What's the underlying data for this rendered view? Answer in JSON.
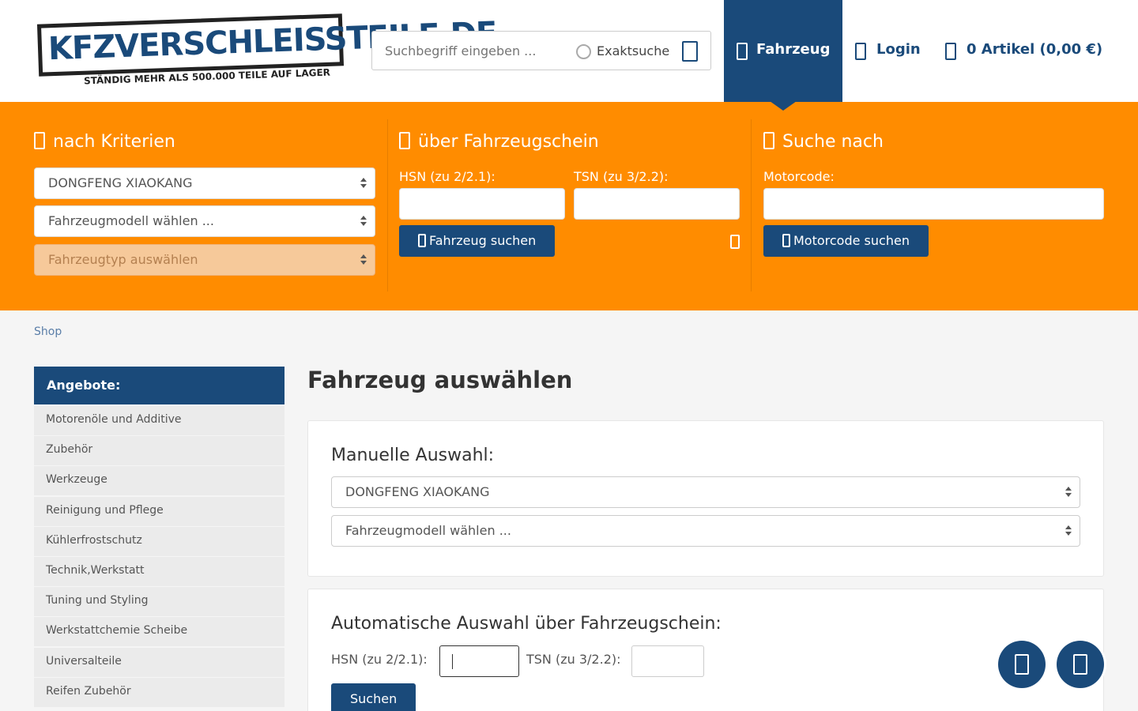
{
  "header": {
    "logo_text": "KFZVERSCHLEISSTEILE.DE",
    "logo_sub": "STÄNDIG MEHR ALS 500.000 TEILE AUF LAGER",
    "search_placeholder": "Suchbegriff eingeben ...",
    "exakt_label": "Exaktsuche",
    "nav_fahrzeug": "Fahrzeug",
    "nav_login": "Login",
    "nav_cart": "0 Artikel (0,00 €)"
  },
  "band": {
    "col1_title": "nach Kriterien",
    "col1_brand": "DONGFENG XIAOKANG",
    "col1_model": "Fahrzeugmodell wählen ...",
    "col1_type": "Fahrzeugtyp auswählen",
    "col2_title": "über Fahrzeugschein",
    "col2_hsn_label": "HSN (zu 2/2.1):",
    "col2_tsn_label": "TSN (zu 3/2.2):",
    "col2_button": "Fahrzeug suchen",
    "col3_title": "Suche nach",
    "col3_motor_label": "Motorcode:",
    "col3_button": "Motorcode suchen"
  },
  "breadcrumb": "Shop",
  "sidebar": {
    "heading": "Angebote:",
    "items": [
      "Motorenöle und Additive",
      "Zubehör",
      "Werkzeuge",
      "Reinigung und Pflege",
      "Kühlerfrostschutz",
      "Technik,Werkstatt",
      "Tuning und Styling",
      "Werkstattchemie Scheibe",
      "Universalteile",
      "Reifen Zubehör"
    ]
  },
  "main": {
    "title": "Fahrzeug auswählen",
    "manual_title": "Manuelle Auswahl:",
    "manual_brand": "DONGFENG XIAOKANG",
    "manual_model": "Fahrzeugmodell wählen ...",
    "auto_title": "Automatische Auswahl über Fahrzeugschein:",
    "auto_hsn_label": "HSN (zu 2/2.1):",
    "auto_tsn_label": "TSN (zu 3/2.2):",
    "auto_button": "Suchen"
  },
  "colors": {
    "brand_blue": "#1a4a7a",
    "accent_orange": "#ff8c00"
  },
  "icons": {
    "search": "search-icon",
    "car": "car-icon",
    "user": "user-icon",
    "cart": "cart-icon",
    "filter": "filter-icon",
    "document": "document-icon",
    "engine": "engine-icon",
    "help": "help-icon",
    "fab_left": "chat-icon",
    "fab_right": "scroll-top-icon"
  }
}
